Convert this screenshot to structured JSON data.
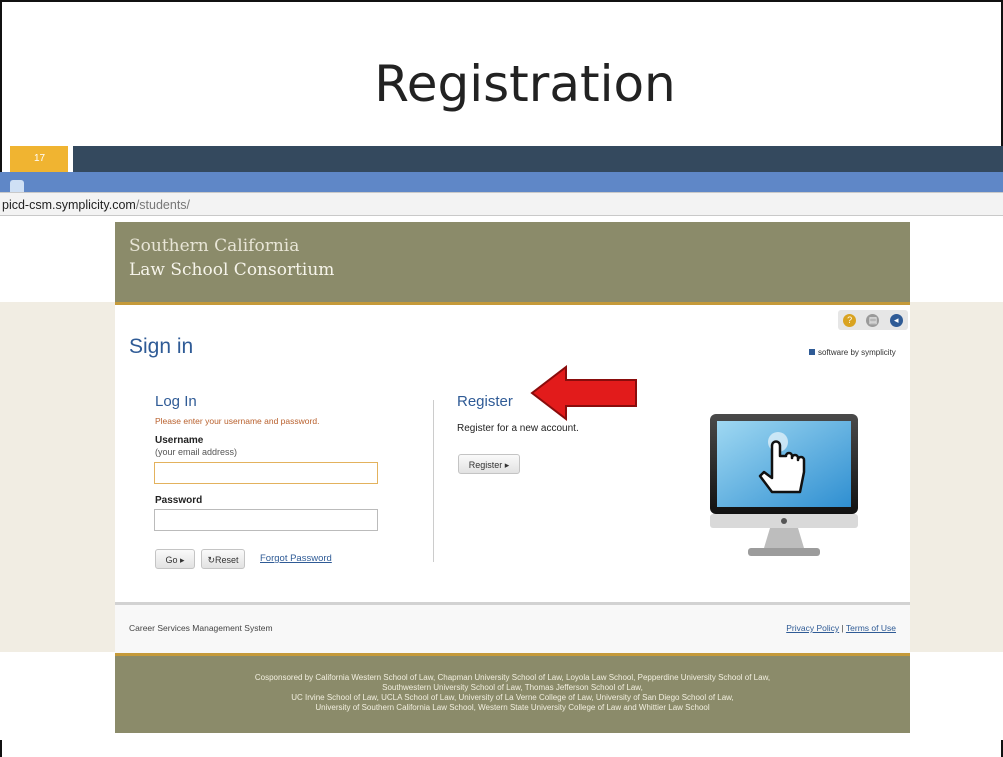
{
  "slide": {
    "title": "Registration",
    "number": "17"
  },
  "browser": {
    "url_host": "picd-csm.symplicity.com",
    "url_path": "/students/"
  },
  "banner": {
    "line1": "Southern California",
    "line2": "Law School Consortium"
  },
  "page": {
    "heading": "Sign in",
    "software_by": "software by symplicity"
  },
  "login": {
    "title": "Log In",
    "hint": "Please enter your username and password.",
    "username_label": "Username",
    "username_sub": "(your email address)",
    "username_value": "",
    "password_label": "Password",
    "password_value": "",
    "go_label": "Go ▸",
    "reset_label": "↻Reset",
    "forgot_label": "Forgot Password"
  },
  "register": {
    "title": "Register",
    "description": "Register for a new account.",
    "button_label": "Register ▸"
  },
  "footer": {
    "left": "Career Services Management System",
    "privacy": "Privacy Policy",
    "separator": " | ",
    "terms": "Terms of Use"
  },
  "cosponsor": {
    "line1": "Cosponsored by California Western School of Law, Chapman University School of Law, Loyola Law School, Pepperdine University School of Law,",
    "line2": "Southwestern University School of Law, Thomas Jefferson School of Law,",
    "line3": "UC Irvine School of Law, UCLA School of Law, University of La Verne College of Law, University of San Diego School of Law,",
    "line4": "University of Southern California Law School, Western State University College of Law and Whittier Law School"
  },
  "colors": {
    "banner": "#8b8b6a",
    "accent_gold": "#c59a3a",
    "link_blue": "#2f5b96",
    "arrow_red": "#e21b1b",
    "slide_bar": "#34495e",
    "slide_number": "#f0b431"
  }
}
